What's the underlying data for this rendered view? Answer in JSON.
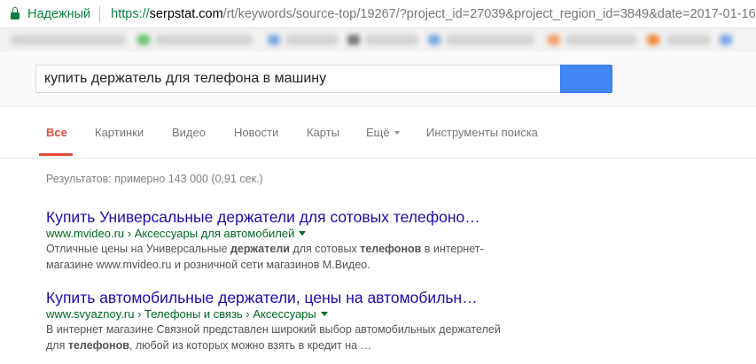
{
  "browser": {
    "secure_label": "Надежный",
    "url_scheme": "https://",
    "url_host": "serpstat.com",
    "url_path": "/rt/keywords/source-top/19267/?project_id=27039&project_region_id=3849&date=2017-01-16"
  },
  "search": {
    "query": "купить держатель для телефона в машину"
  },
  "tabs": [
    {
      "label": "Все",
      "active": true
    },
    {
      "label": "Картинки"
    },
    {
      "label": "Видео"
    },
    {
      "label": "Новости"
    },
    {
      "label": "Карты"
    },
    {
      "label": "Ещё"
    },
    {
      "label": "Инструменты поиска"
    }
  ],
  "results_stats": "Результатов: примерно 143 000 (0,91 сек.)",
  "results": [
    {
      "title": "Купить Универсальные держатели для сотовых телефоно…",
      "url": "www.mvideo.ru › Аксессуары для автомобилей",
      "snippet": [
        {
          "t": "Отличные цены на Универсальные "
        },
        {
          "t": "держатели",
          "b": true
        },
        {
          "t": " для сотовых "
        },
        {
          "t": "телефонов",
          "b": true
        },
        {
          "t": " в интернет-магазине www.mvideo.ru и розничной сети магазинов М.Видео."
        }
      ]
    },
    {
      "title": "Купить автомобильные держатели, цены на автомобильн…",
      "url": "www.svyaznoy.ru › Телефоны и связь › Аксессуары",
      "snippet": [
        {
          "t": "В интернет магазине Связной представлен широкий выбор автомобильных держателей для "
        },
        {
          "t": "телефонов",
          "b": true
        },
        {
          "t": ", любой из которых можно взять в кредит на …"
        }
      ]
    }
  ],
  "colors": {
    "secure_green": "#0b8043",
    "link_blue": "#1a0dab",
    "url_green": "#006621",
    "active_tab_red": "#dd4b39",
    "search_button_blue": "#4285f4"
  }
}
